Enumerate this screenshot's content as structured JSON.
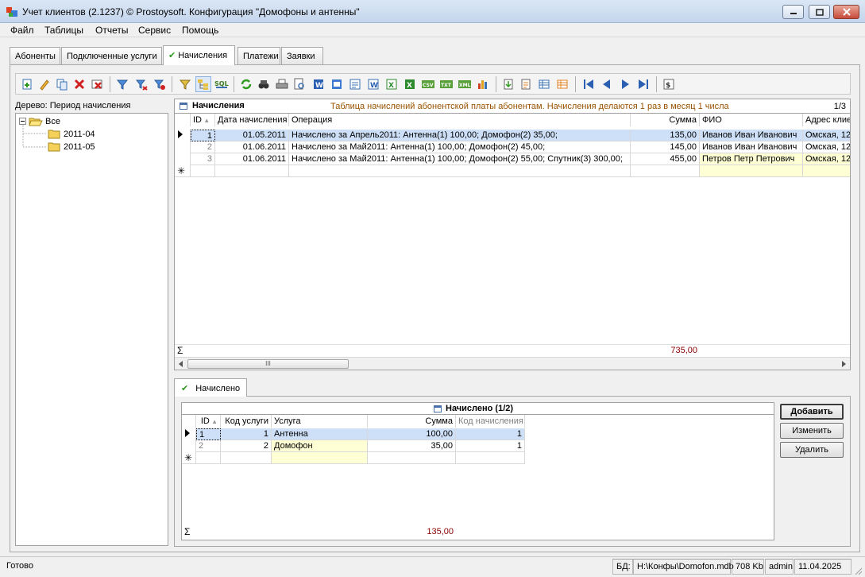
{
  "window": {
    "title": "Учет клиентов (2.1237) © Prostoysoft. Конфигурация \"Домофоны и антенны\""
  },
  "menu": [
    "Файл",
    "Таблицы",
    "Отчеты",
    "Сервис",
    "Помощь"
  ],
  "tabs": [
    {
      "label": "Абоненты"
    },
    {
      "label": "Подключенные услуги"
    },
    {
      "label": "Начисления",
      "active": true
    },
    {
      "label": "Платежи"
    },
    {
      "label": "Заявки"
    }
  ],
  "toolbar_icons": [
    "export-icon",
    "edit-icon",
    "copy-icon",
    "delete-icon",
    "delete-all-icon",
    "filter-icon",
    "filter-add-icon",
    "filter-remove-icon",
    "filter-tree-icon",
    "tree-icon",
    "sql-icon",
    "refresh-icon",
    "find-icon",
    "print-icon",
    "preview-icon",
    "word-icon",
    "word-export-icon",
    "report-icon",
    "word-list-icon",
    "excel-icon",
    "excel-export-icon",
    "csv-icon",
    "txt-icon",
    "xml-icon",
    "chart-icon",
    "import-icon",
    "import-list-icon",
    "table-icon",
    "table-export-icon",
    "first-icon",
    "prev-icon",
    "next-icon",
    "last-icon",
    "calc-icon"
  ],
  "tree": {
    "label": "Дерево: Период начисления",
    "root": "Все",
    "children": [
      "2011-04",
      "2011-05"
    ]
  },
  "charges": {
    "title": "Начисления",
    "description": "Таблица начислений абонентской платы абонентам. Начисления делаются 1 раз в месяц 1 числа",
    "counter": "1/3",
    "columns": [
      "ID",
      "Дата начисления",
      "Операция",
      "Сумма",
      "ФИО",
      "Адрес клие"
    ],
    "rows": [
      {
        "id": "1",
        "date": "01.05.2011",
        "operation": "Начислено за Апрель2011: Антенна(1) 100,00; Домофон(2) 35,00;",
        "sum": "135,00",
        "fio": "Иванов Иван Иванович",
        "address": "Омская, 12"
      },
      {
        "id": "2",
        "date": "01.06.2011",
        "operation": "Начислено за Май2011: Антенна(1) 100,00; Домофон(2) 45,00;",
        "sum": "145,00",
        "fio": "Иванов Иван Иванович",
        "address": "Омская, 12"
      },
      {
        "id": "3",
        "date": "01.06.2011",
        "operation": "Начислено за Май2011: Антенна(1) 100,00; Домофон(2) 55,00; Спутник(3) 300,00;",
        "sum": "455,00",
        "fio": "Петров Петр Петрович",
        "address": "Омская, 12"
      }
    ],
    "total": "735,00"
  },
  "subtab": {
    "label": "Начислено"
  },
  "accrued": {
    "title": "Начислено (1/2)",
    "columns": [
      "ID",
      "Код услуги",
      "Услуга",
      "Сумма",
      "Код начисления"
    ],
    "rows": [
      {
        "id": "1",
        "code": "1",
        "service": "Антенна",
        "sum": "100,00",
        "charge_code": "1"
      },
      {
        "id": "2",
        "code": "2",
        "service": "Домофон",
        "sum": "35,00",
        "charge_code": "1"
      }
    ],
    "total": "135,00"
  },
  "buttons": {
    "add": "Добавить",
    "edit": "Изменить",
    "delete": "Удалить"
  },
  "status": {
    "ready": "Готово",
    "db_label": "БД:",
    "db_path": "H:\\Конфы\\Domofon.mdb",
    "db_size": "708 Kb",
    "user": "admin",
    "date": "11.04.2025"
  }
}
